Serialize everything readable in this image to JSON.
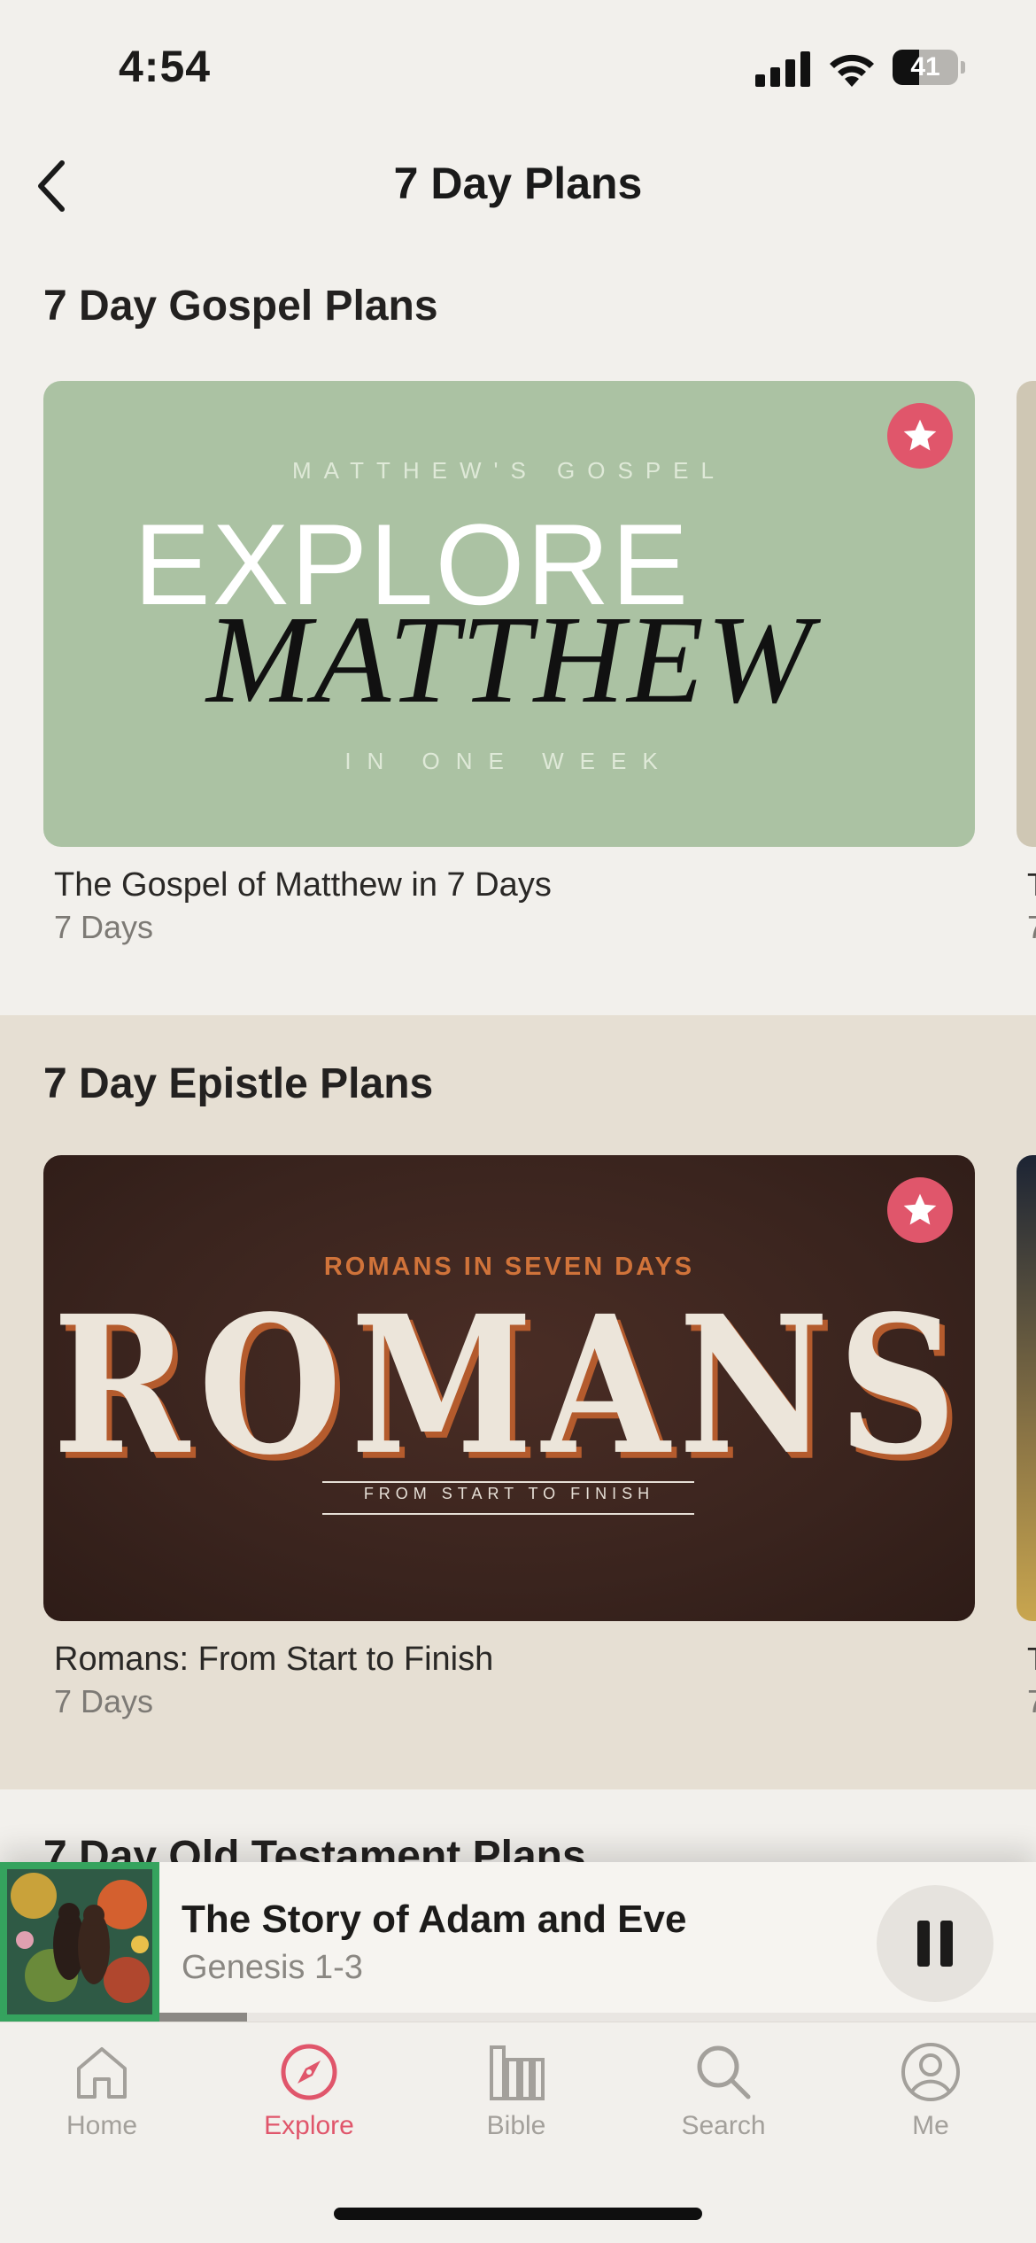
{
  "status_bar": {
    "time": "4:54",
    "battery_level": "41",
    "battery_fraction": 0.41
  },
  "nav": {
    "title": "7 Day Plans",
    "back_icon": "chevron-left-icon"
  },
  "sections": [
    {
      "title": "7 Day Gospel Plans",
      "plans": [
        {
          "title": "The Gospel of Matthew in 7 Days",
          "duration": "7 Days",
          "favorite": true,
          "artwork": {
            "top_text": "MATTHEW'S GOSPEL",
            "line1": "EXPLORE",
            "line2": "MATTHEW",
            "bottom_text": "IN ONE WEEK"
          }
        }
      ]
    },
    {
      "title": "7 Day Epistle Plans",
      "plans": [
        {
          "title": "Romans: From Start to Finish",
          "duration": "7 Days",
          "favorite": true,
          "artwork": {
            "top_text": "ROMANS IN SEVEN DAYS",
            "main_text": "ROMANS",
            "sub_text": "FROM START TO FINISH"
          }
        }
      ]
    },
    {
      "title": "7 Day Old Testament Plans"
    }
  ],
  "peek": {
    "gospel_title_char": "T",
    "gospel_duration_char": "7",
    "epistle_title_char": "T",
    "epistle_duration_char": "7"
  },
  "now_playing": {
    "title": "The Story of Adam and Eve",
    "subtitle": "Genesis 1-3",
    "progress_fraction": 0.1,
    "button_icon": "pause-icon"
  },
  "tabs": [
    {
      "label": "Home",
      "icon": "home-icon",
      "active": false
    },
    {
      "label": "Explore",
      "icon": "compass-icon",
      "active": true
    },
    {
      "label": "Bible",
      "icon": "books-icon",
      "active": false
    },
    {
      "label": "Search",
      "icon": "search-icon",
      "active": false
    },
    {
      "label": "Me",
      "icon": "profile-icon",
      "active": false
    }
  ],
  "colors": {
    "accent": "#e0566b",
    "background": "#f2f0ec",
    "epistle_background": "#e6dfd3",
    "now_playing_border": "#35a35e"
  }
}
